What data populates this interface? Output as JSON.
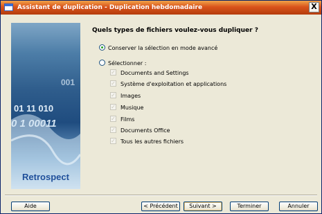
{
  "window": {
    "title": "Assistant de duplication - Duplication hebdomadaire",
    "close_label": "X"
  },
  "banner": {
    "logo_text": "Retrospect",
    "digits": [
      "001",
      "01 11 010",
      "0 1 00011"
    ]
  },
  "main": {
    "question": "Quels types de fichiers voulez-vous dupliquer ?",
    "options": [
      {
        "label": "Conserver la sélection en mode avancé",
        "selected": true
      },
      {
        "label": "Sélectionner :",
        "selected": false
      }
    ],
    "file_types": [
      {
        "label": "Documents and Settings",
        "checked": true
      },
      {
        "label": "Système d'exploitation et applications",
        "checked": true
      },
      {
        "label": "Images",
        "checked": true
      },
      {
        "label": "Musique",
        "checked": true
      },
      {
        "label": "Films",
        "checked": true
      },
      {
        "label": "Documents Office",
        "checked": true
      },
      {
        "label": "Tous les autres fichiers",
        "checked": true
      }
    ]
  },
  "buttons": {
    "help": "Aide",
    "previous": "< Précédent",
    "next": "Suivant >",
    "finish": "Terminer",
    "cancel": "Annuler"
  },
  "colors": {
    "title_bar": "#d9531b",
    "dialog_bg": "#ece9d8",
    "banner_blue": "#2f5d8c"
  }
}
